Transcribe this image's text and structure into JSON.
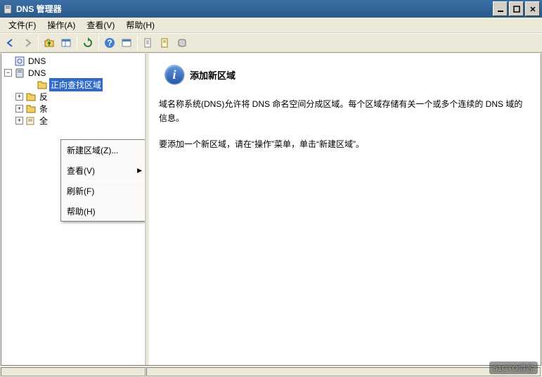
{
  "title": "DNS 管理器",
  "menubar": {
    "file": "文件(F)",
    "action": "操作(A)",
    "view": "查看(V)",
    "help": "帮助(H)"
  },
  "tree": {
    "root": "DNS",
    "server": "DNS",
    "items": [
      {
        "label": "正向查找区域",
        "selected": true
      },
      {
        "label": "反",
        "expandable": true
      },
      {
        "label": "条",
        "expandable": true
      },
      {
        "label": "全",
        "expandable": true,
        "log": true
      }
    ]
  },
  "contextMenu": {
    "items": {
      "newZone": "新建区域(Z)...",
      "view": "查看(V)",
      "refresh": "刷新(F)",
      "help": "帮助(H)"
    }
  },
  "content": {
    "title": "添加新区域",
    "p1": "域名称系统(DNS)允许将 DNS 命名空间分成区域。每个区域存储有关一个或多个连续的 DNS 域的信息。",
    "p2": "要添加一个新区域，请在“操作”菜单，单击“新建区域”。"
  },
  "watermark": "51CTO博客"
}
